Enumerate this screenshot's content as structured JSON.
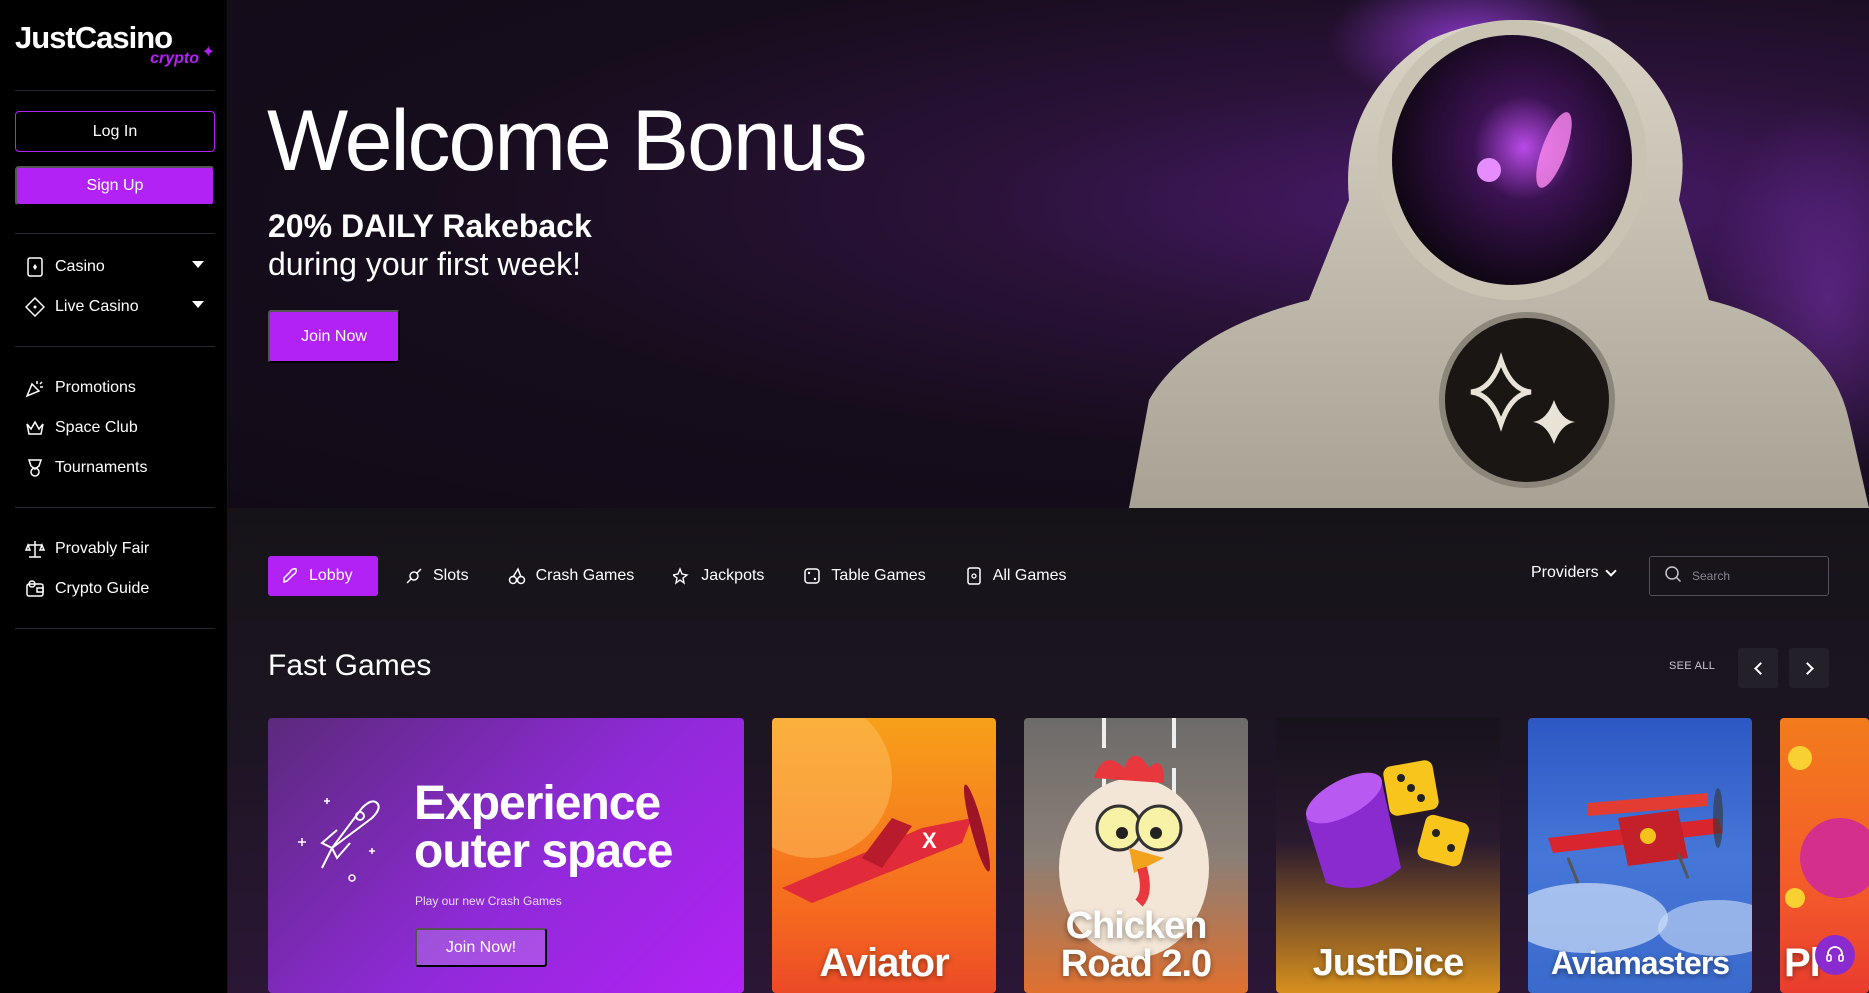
{
  "brand": {
    "name": "JustCasino",
    "sub": "crypto"
  },
  "auth": {
    "login_label": "Log In",
    "signup_label": "Sign Up"
  },
  "sidebar": {
    "groups": [
      {
        "items": [
          {
            "label": "Casino",
            "icon": "card-icon"
          },
          {
            "label": "Live Casino",
            "icon": "diamond-card-icon"
          }
        ]
      },
      {
        "items": [
          {
            "label": "Promotions",
            "icon": "party-icon"
          },
          {
            "label": "Space Club",
            "icon": "crown-icon"
          },
          {
            "label": "Tournaments",
            "icon": "trophy-icon"
          }
        ]
      },
      {
        "items": [
          {
            "label": "Provably Fair",
            "icon": "scales-icon"
          },
          {
            "label": "Crypto Guide",
            "icon": "wallet-icon"
          }
        ]
      }
    ]
  },
  "hero": {
    "title": "Welcome Bonus",
    "subtitle_bold": "20% DAILY Rakeback",
    "subtitle": "during your first week!",
    "cta": "Join Now"
  },
  "tabs": [
    {
      "label": "Lobby",
      "icon": "rocket-icon",
      "active": true
    },
    {
      "label": "Slots",
      "icon": "candy-icon"
    },
    {
      "label": "Crash Games",
      "icon": "cherries-icon"
    },
    {
      "label": "Jackpots",
      "icon": "stars-icon"
    },
    {
      "label": "Table Games",
      "icon": "dice-icon"
    },
    {
      "label": "All Games",
      "icon": "cards-icon"
    }
  ],
  "providers_label": "Providers",
  "search": {
    "placeholder": "Search"
  },
  "section": {
    "title": "Fast Games",
    "see_all": "SEE ALL"
  },
  "promo": {
    "heading_line1": "Experience",
    "heading_line2": "outer space",
    "text": "Play our new Crash Games",
    "cta": "Join Now!"
  },
  "games": [
    {
      "name": "Aviator"
    },
    {
      "name": "Chicken Road 2.0"
    },
    {
      "name": "JustDice"
    },
    {
      "name": "Aviamasters"
    },
    {
      "name": "Pl"
    }
  ],
  "colors": {
    "accent": "#b322f5",
    "sidebar": "#000000",
    "content": "#161318"
  }
}
